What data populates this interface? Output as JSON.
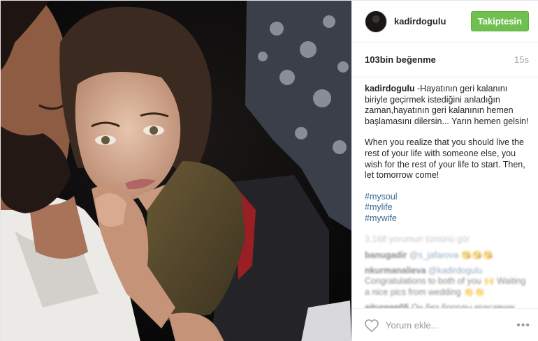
{
  "post": {
    "username": "kadirdogulu",
    "follow_label": "Takiptesin",
    "likes": "103bin beğenme",
    "age": "15s"
  },
  "caption": {
    "username": "kadirdogulu",
    "text_tr": "-Hayatının geri kalanını biriyle geçirmek istediğini anladığın zaman,hayatının geri kalanının hemen başlamasını dilersin... Yarın hemen gelsin!",
    "text_en": "When you realize that you should live the rest of your life with someone else, you wish for the rest of your life to start. Then, let tomorrow come!",
    "tags": [
      "#mysoul",
      "#mylife",
      "#mywife"
    ]
  },
  "comments": {
    "more_label": "3.168 yorumun tümünü gör",
    "items": [
      {
        "user": "banugadir",
        "mention": "@s_jafarova",
        "text": "😘😘😘"
      },
      {
        "user": "nkurmanalieva",
        "mention": "@kadirdogulu",
        "text": "Congratulations to both of you 🙌 Waiting a nice pics from wedding 👏👏"
      },
      {
        "user": "aiturgan05",
        "mention": "",
        "text": "Он без бороды красавчик"
      }
    ]
  },
  "footer": {
    "placeholder": "Yorum ekle...",
    "more_icon": "•••"
  },
  "icons": {
    "heart": "heart-icon",
    "more": "more-options-icon"
  },
  "colors": {
    "follow_green": "#70c050",
    "link_blue": "#3d6a91"
  }
}
